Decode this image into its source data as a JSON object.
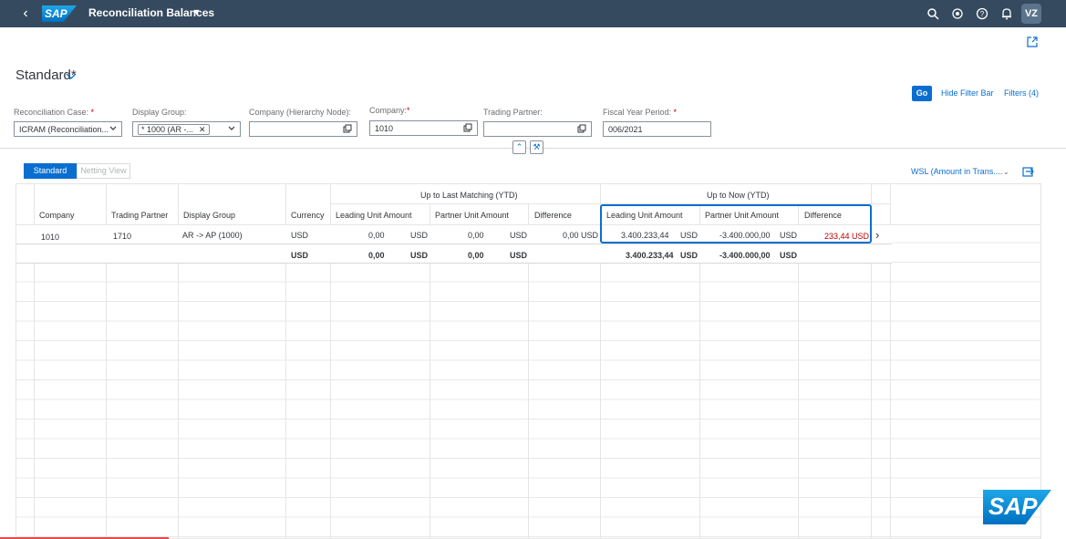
{
  "shell": {
    "title": "Reconciliation Balances",
    "avatar": "VZ",
    "logo": "SAP"
  },
  "variant": {
    "name": "Standard*"
  },
  "filterbar": {
    "go": "Go",
    "hide": "Hide Filter Bar",
    "filters": "Filters (4)",
    "fields": [
      {
        "label": "Reconciliation Case:",
        "required": true,
        "value": "ICRAM (Reconciliation..."
      },
      {
        "label": "Display Group:",
        "required": false,
        "token": "* 1000 (AR -..."
      },
      {
        "label": "Company (Hierarchy Node):",
        "required": false,
        "value": ""
      },
      {
        "label": "Company:",
        "required": true,
        "value": "1010"
      },
      {
        "label": "Trading Partner:",
        "required": false,
        "value": ""
      },
      {
        "label": "Fiscal Year Period:",
        "required": true,
        "value": "006/2021"
      }
    ]
  },
  "toolbar": {
    "seg_standard": "Standard",
    "seg_netting": "Netting View",
    "wsl": "WSL (Amount in Trans...."
  },
  "table": {
    "group1": "Up to Last Matching (YTD)",
    "group2": "Up to Now (YTD)",
    "headers": [
      "Company",
      "Trading Partner",
      "Display Group",
      "Currency",
      "Leading Unit Amount",
      "Partner Unit Amount",
      "Difference",
      "Leading Unit Amount",
      "Partner Unit Amount",
      "Difference"
    ],
    "row": {
      "company": "1010",
      "partner": "1710",
      "group": "AR -> AP (1000)",
      "currency": "USD",
      "lm_lead": "0,00",
      "lm_lead_cur": "USD",
      "lm_part": "0,00",
      "lm_part_cur": "USD",
      "lm_diff": "0,00 USD",
      "now_lead": "3.400.233,44",
      "now_lead_cur": "USD",
      "now_part": "-3.400.000,00",
      "now_part_cur": "USD",
      "now_diff": "233,44 USD"
    },
    "total": {
      "currency": "USD",
      "lm_lead": "0,00",
      "lm_lead_cur": "USD",
      "lm_part": "0,00",
      "lm_part_cur": "USD",
      "now_lead": "3.400.233,44",
      "now_lead_cur": "USD",
      "now_part": "-3.400.000,00",
      "now_part_cur": "USD"
    }
  },
  "colors": {
    "shell": "#354a5f",
    "accent": "#0a6ed1",
    "negative": "#bb0000"
  }
}
